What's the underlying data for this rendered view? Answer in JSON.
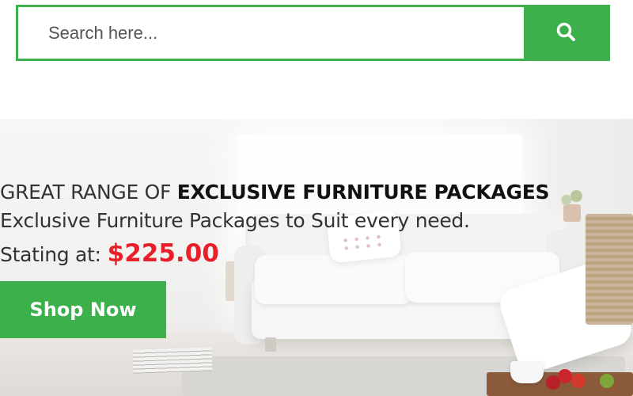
{
  "search": {
    "placeholder": "Search here...",
    "button_icon": "search-icon"
  },
  "banner": {
    "headline_light": "GREAT RANGE OF ",
    "headline_bold": "EXCLUSIVE FURNITURE PACKAGES",
    "subtitle": "Exclusive Furniture Packages to Suit every need.",
    "price_label": "Stating at:",
    "price_value": "$225.00",
    "cta_label": "Shop Now"
  },
  "colors": {
    "accent_green": "#3cb04a",
    "price_red": "#e8202a"
  }
}
